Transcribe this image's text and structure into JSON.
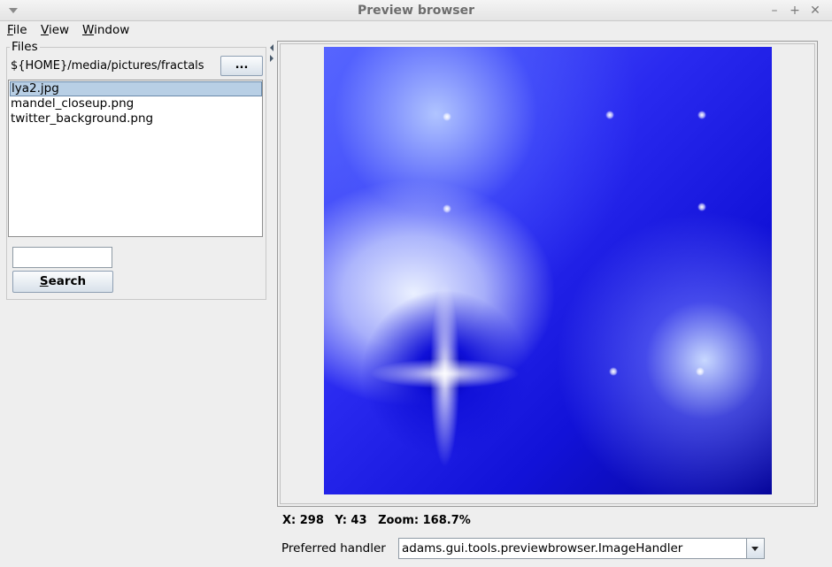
{
  "window": {
    "title": "Preview browser",
    "controls": {
      "minimize": "–",
      "maximize": "+",
      "close": "✕"
    }
  },
  "menu": {
    "file": {
      "underlined": "F",
      "rest": "ile"
    },
    "view": {
      "underlined": "V",
      "rest": "iew"
    },
    "window": {
      "underlined": "W",
      "rest": "indow"
    }
  },
  "files": {
    "legend": "Files",
    "path": "${HOME}/media/pictures/fractals",
    "browse_label": "...",
    "items": [
      {
        "name": "lya2.jpg",
        "selected": true
      },
      {
        "name": "mandel_closeup.png",
        "selected": false
      },
      {
        "name": "twitter_background.png",
        "selected": false
      }
    ],
    "search_value": "",
    "search_button": {
      "underlined": "S",
      "rest": "earch"
    }
  },
  "preview": {
    "status": {
      "x": "X: 298",
      "y": "Y: 43",
      "zoom": "Zoom: 168.7%"
    },
    "handler_label": "Preferred handler",
    "handler_value": "adams.gui.tools.previewbrowser.ImageHandler"
  },
  "colors": {
    "selection": "#b8cfe5",
    "button_top": "#fbfcfd",
    "button_bottom": "#d8e1ea",
    "fractal_dark": "#06069a",
    "fractal_light": "#eaf0ff"
  }
}
